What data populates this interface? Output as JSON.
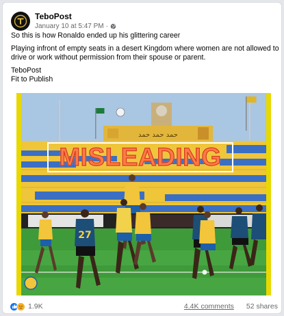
{
  "post": {
    "page_name": "TeboPost",
    "timestamp": "January 10 at 5:47 PM",
    "separator": "·",
    "audience_icon": "globe-icon",
    "line1": "So this is how Ronaldo ended up his glittering career",
    "line2": "Playing infront of empty seats in a desert Kingdom where women are not allowed to drive or work without permission from their spouse or parent.",
    "line3": "TeboPost",
    "line4": "Fit to Publish"
  },
  "media": {
    "overlay_label": "MISLEADING",
    "jersey_number": "27",
    "border_color": "#e8d800",
    "overlay_color": "#ff7a45"
  },
  "footer": {
    "reaction_icons": [
      "like-icon",
      "sad-icon"
    ],
    "reaction_count": "1.9K",
    "comments": "4.4K comments",
    "shares": "52 shares"
  }
}
